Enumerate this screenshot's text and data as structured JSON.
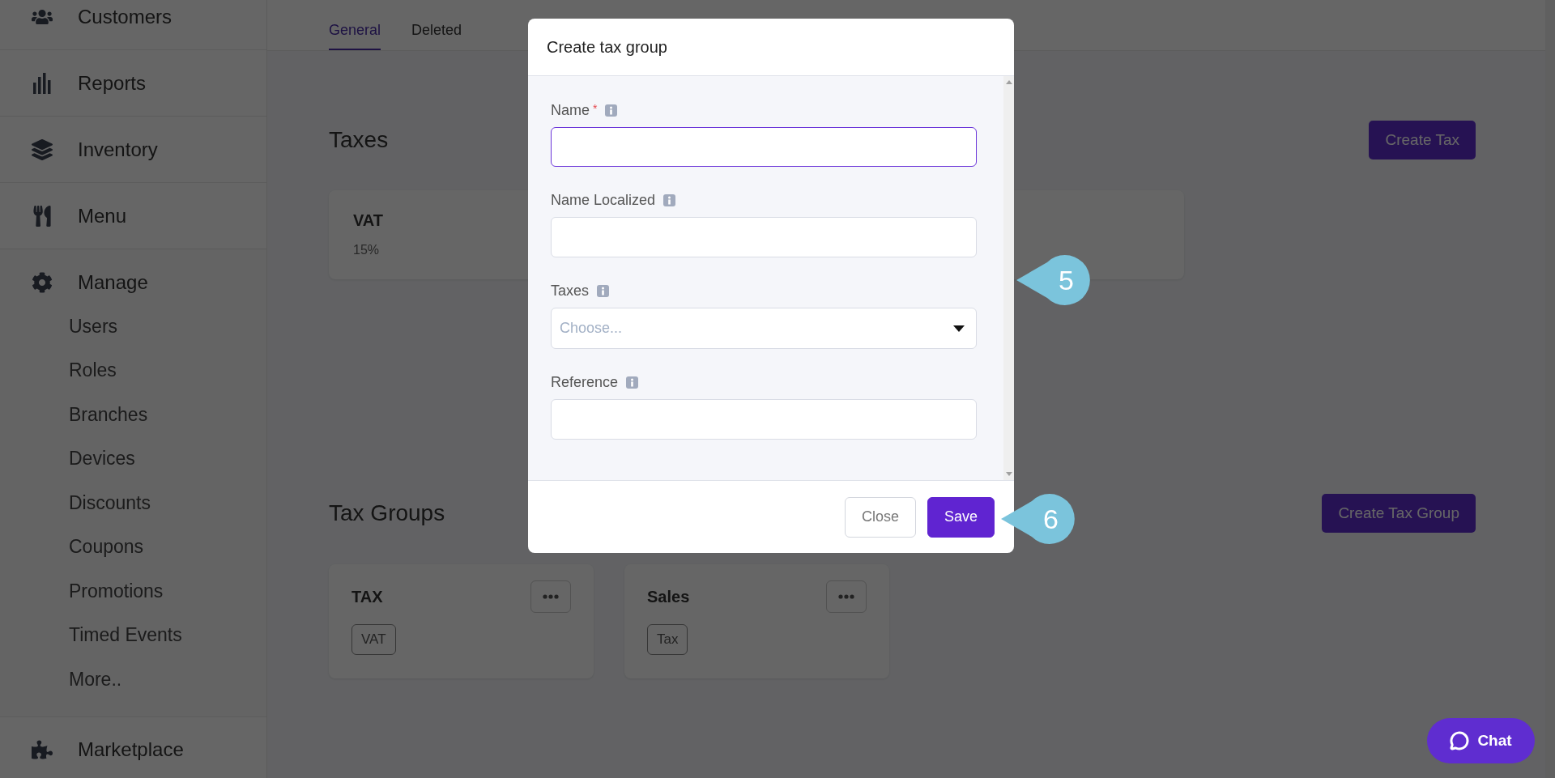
{
  "sidebar": {
    "items": [
      {
        "label": "Customers"
      },
      {
        "label": "Reports"
      },
      {
        "label": "Inventory"
      },
      {
        "label": "Menu"
      },
      {
        "label": "Manage",
        "children": [
          {
            "label": "Users"
          },
          {
            "label": "Roles"
          },
          {
            "label": "Branches"
          },
          {
            "label": "Devices"
          },
          {
            "label": "Discounts"
          },
          {
            "label": "Coupons"
          },
          {
            "label": "Promotions"
          },
          {
            "label": "Timed Events"
          },
          {
            "label": "More.."
          }
        ]
      },
      {
        "label": "Marketplace"
      }
    ]
  },
  "tabs": [
    {
      "label": "General",
      "selected": true
    },
    {
      "label": "Deleted",
      "selected": false
    }
  ],
  "taxes": {
    "title": "Taxes",
    "create_button": "Create Tax",
    "cards": [
      {
        "name": "VAT",
        "rate": "15%"
      }
    ]
  },
  "tax_groups": {
    "title": "Tax Groups",
    "create_button": "Create Tax Group",
    "cards": [
      {
        "name": "TAX",
        "tags": [
          "VAT"
        ]
      },
      {
        "name": "Sales",
        "tags": [
          "Tax"
        ]
      }
    ]
  },
  "modal": {
    "title": "Create tax group",
    "required_mark": "*",
    "fields": [
      {
        "label": "Name",
        "kind": "text",
        "required": true,
        "focused": true
      },
      {
        "label": "Name Localized",
        "kind": "text",
        "required": false,
        "focused": false
      },
      {
        "label": "Taxes",
        "kind": "select",
        "required": false,
        "focused": false,
        "placeholder": "Choose..."
      },
      {
        "label": "Reference",
        "kind": "text",
        "required": false,
        "focused": false
      }
    ],
    "buttons": [
      {
        "label": "Close",
        "kind": "secondary"
      },
      {
        "label": "Save",
        "kind": "primary"
      }
    ]
  },
  "callouts": [
    {
      "number": "5"
    },
    {
      "number": "6"
    }
  ],
  "chat": {
    "label": "Chat"
  }
}
